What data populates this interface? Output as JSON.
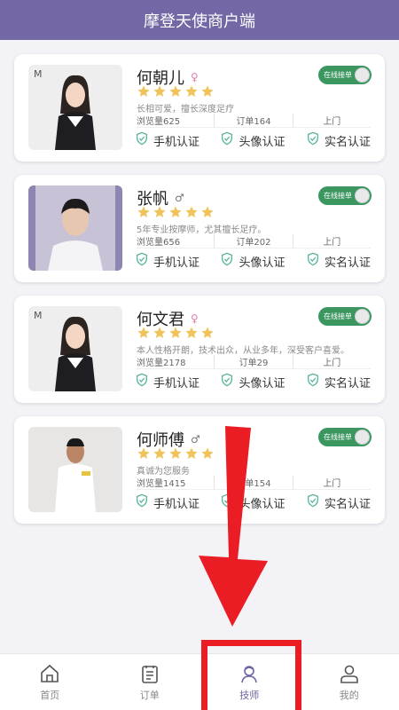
{
  "header": {
    "title": "摩登天使商户端"
  },
  "toggle_label": "在线接单",
  "technicians": [
    {
      "name": "何朝儿",
      "gender": "♀",
      "gender_class": "f",
      "desc": "长相可爱，擅长深度足疗",
      "views": "浏览量625",
      "orders": "订单164",
      "service": "上门",
      "certs": [
        "手机认证",
        "头像认证",
        "实名认证"
      ],
      "photo": "female-1"
    },
    {
      "name": "张帆",
      "gender": "♂",
      "gender_class": "m",
      "desc": "5年专业按摩师，尤其擅长足疗。",
      "views": "浏览量656",
      "orders": "订单202",
      "service": "上门",
      "certs": [
        "手机认证",
        "头像认证",
        "实名认证"
      ],
      "photo": "male-1"
    },
    {
      "name": "何文君",
      "gender": "♀",
      "gender_class": "f",
      "desc": "本人性格开朗，技术出众，从业多年，深受客户喜爱。",
      "views": "浏览量2178",
      "orders": "订单29",
      "service": "上门",
      "certs": [
        "手机认证",
        "头像认证",
        "实名认证"
      ],
      "photo": "female-2"
    },
    {
      "name": "何师傅",
      "gender": "♂",
      "gender_class": "m",
      "desc": "真诚为您服务",
      "views": "浏览量1415",
      "orders": "订单154",
      "service": "上门",
      "certs": [
        "手机认证",
        "头像认证",
        "实名认证"
      ],
      "photo": "male-2"
    }
  ],
  "tabs": [
    {
      "label": "首页",
      "icon": "home-icon"
    },
    {
      "label": "订单",
      "icon": "order-icon"
    },
    {
      "label": "技师",
      "icon": "technician-icon",
      "active": true
    },
    {
      "label": "我的",
      "icon": "profile-icon"
    }
  ],
  "colors": {
    "header": "#7367a5",
    "toggle": "#3b9660",
    "star": "#f0c35a",
    "cert": "#5ab4a0",
    "highlight": "#ea1c24"
  }
}
